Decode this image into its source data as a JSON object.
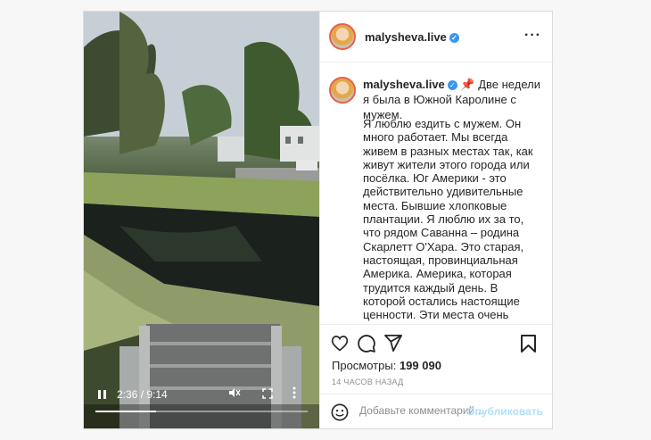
{
  "post": {
    "username": "malysheva.live",
    "verified_icon": "verified-badge-icon",
    "more_icon": "more-options-icon",
    "caption_lead": "📌 Две недели я была в Южной Каролине с мужем.",
    "caption_body": "Я люблю ездить с мужем. Он много работает. Мы всегда живем в разных местах так, как живут жители этого города или посёлка. Юг Америки - это действительно удивительные места. Бывшие хлопковые плантации. Я люблю их за то, что рядом Саванна – родина Скарлетт О'Хара. Это старая, настоящая, провинциальная Америка. Америка, которая трудится каждый день. В которой остались настоящие ценности. Эти места очень отличаются от американских мегаполисов, где все политизировано невероятно. Одним словом, здесь живут трудовые люди",
    "views_label": "Просмотры:",
    "views_value": "199 090",
    "time_ago": "14 часов назад",
    "comment_placeholder": "Добавьте комментарий...",
    "publish_label": "Опубликовать"
  },
  "video": {
    "time": "2:36 / 9:14",
    "progress_fraction": 0.284,
    "icons": [
      "pause-icon",
      "muted-speaker-icon",
      "fullscreen-icon",
      "more-vertical-icon"
    ]
  },
  "actions": {
    "icons": [
      "heart-icon",
      "comment-icon",
      "share-icon",
      "bookmark-icon"
    ]
  },
  "colors": {
    "accent": "#3897f0",
    "publish_disabled": "#b2dffc",
    "muted_text": "#8e8e8e",
    "border": "#dbdbdb"
  }
}
